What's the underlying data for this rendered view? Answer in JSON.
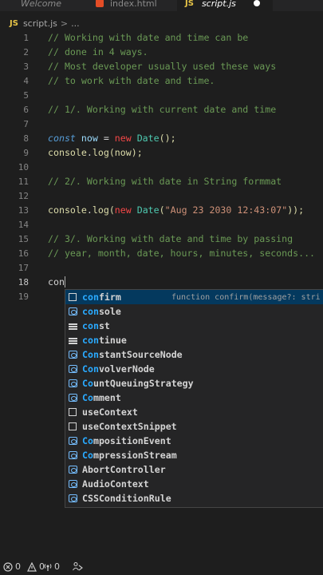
{
  "tabs": [
    {
      "label": "Welcome",
      "icon": "vscode-icon",
      "active": false
    },
    {
      "label": "index.html",
      "icon": "html-file-icon",
      "active": false
    },
    {
      "label": "script.js",
      "icon": "js-file-icon",
      "active": true,
      "badge": "JS"
    }
  ],
  "breadcrumb": {
    "badge": "JS",
    "file": "script.js",
    "sep": ">",
    "more": "..."
  },
  "editor": {
    "current_line": 18,
    "typed": "con",
    "lines": [
      {
        "n": "1",
        "parts": [
          {
            "t": "// Working with date and time can be",
            "c": "c"
          }
        ]
      },
      {
        "n": "2",
        "parts": [
          {
            "t": "// done in 4 ways.",
            "c": "c"
          }
        ]
      },
      {
        "n": "3",
        "parts": [
          {
            "t": "// Most developer usually used these ways",
            "c": "c"
          }
        ]
      },
      {
        "n": "4",
        "parts": [
          {
            "t": "// to work with date and time.",
            "c": "c"
          }
        ]
      },
      {
        "n": "5",
        "parts": []
      },
      {
        "n": "6",
        "parts": [
          {
            "t": "// 1/. Working with current date and time",
            "c": "c"
          }
        ]
      },
      {
        "n": "7",
        "parts": []
      },
      {
        "n": "8",
        "parts": [
          {
            "t": "const",
            "c": "k"
          },
          {
            "t": " now ",
            "c": "v"
          },
          {
            "t": "=",
            "c": "w"
          },
          {
            "t": " new ",
            "c": "r"
          },
          {
            "t": "Date",
            "c": "p"
          },
          {
            "t": "();",
            "c": "y"
          }
        ]
      },
      {
        "n": "9",
        "parts": [
          {
            "t": "console",
            "c": "y"
          },
          {
            "t": ".",
            "c": "w"
          },
          {
            "t": "log",
            "c": "y"
          },
          {
            "t": "(now);",
            "c": "y"
          }
        ]
      },
      {
        "n": "10",
        "parts": []
      },
      {
        "n": "11",
        "parts": [
          {
            "t": "// 2/. Working with date in String formmat",
            "c": "c"
          }
        ]
      },
      {
        "n": "12",
        "parts": []
      },
      {
        "n": "13",
        "parts": [
          {
            "t": "console",
            "c": "y"
          },
          {
            "t": ".",
            "c": "w"
          },
          {
            "t": "log",
            "c": "y"
          },
          {
            "t": "(",
            "c": "y"
          },
          {
            "t": "new ",
            "c": "r"
          },
          {
            "t": "Date",
            "c": "p"
          },
          {
            "t": "(",
            "c": "y"
          },
          {
            "t": "\"Aug 23 2030 12:43:07\"",
            "c": "s"
          },
          {
            "t": "));",
            "c": "y"
          }
        ]
      },
      {
        "n": "14",
        "parts": []
      },
      {
        "n": "15",
        "parts": [
          {
            "t": "// 3/. Working with date and time by passing",
            "c": "c"
          }
        ]
      },
      {
        "n": "16",
        "parts": [
          {
            "t": "// year, month, date, hours, minutes, seconds...",
            "c": "c"
          }
        ]
      },
      {
        "n": "17",
        "parts": []
      },
      {
        "n": "18",
        "parts": [
          {
            "t": "con",
            "c": "w"
          }
        ]
      },
      {
        "n": "19",
        "parts": []
      }
    ]
  },
  "suggest": {
    "selected_index": 0,
    "match": "con",
    "items": [
      {
        "hl": "con",
        "rest": "firm",
        "icon": "box",
        "detail": "function confirm(message?: stri"
      },
      {
        "hl": "con",
        "rest": "sole",
        "icon": "var"
      },
      {
        "hl": "con",
        "rest": "st",
        "icon": "kw"
      },
      {
        "hl": "con",
        "rest": "tinue",
        "icon": "kw"
      },
      {
        "hl": "Con",
        "rest": "stantSourceNode",
        "icon": "var"
      },
      {
        "hl": "Con",
        "rest": "volverNode",
        "icon": "var"
      },
      {
        "hl": "Co",
        "rest": "untQueuingStrategy",
        "icon": "var",
        "mid": true
      },
      {
        "hl": "Co",
        "rest": "mment",
        "icon": "var",
        "mid": true
      },
      {
        "hl": "",
        "rest": "useContext",
        "icon": "box"
      },
      {
        "hl": "",
        "rest": "useContextSnippet",
        "icon": "box"
      },
      {
        "hl": "Co",
        "rest": "mpositionEvent",
        "icon": "var",
        "mid": true
      },
      {
        "hl": "Co",
        "rest": "mpressionStream",
        "icon": "var",
        "mid": true
      },
      {
        "hl": "",
        "rest": "AbortController",
        "icon": "var"
      },
      {
        "hl": "",
        "rest": "AudioContext",
        "icon": "var"
      },
      {
        "hl": "",
        "rest": "CSSConditionRule",
        "icon": "var"
      }
    ]
  },
  "statusbar": {
    "errors": "0",
    "warnings": "0",
    "ports": "0"
  }
}
